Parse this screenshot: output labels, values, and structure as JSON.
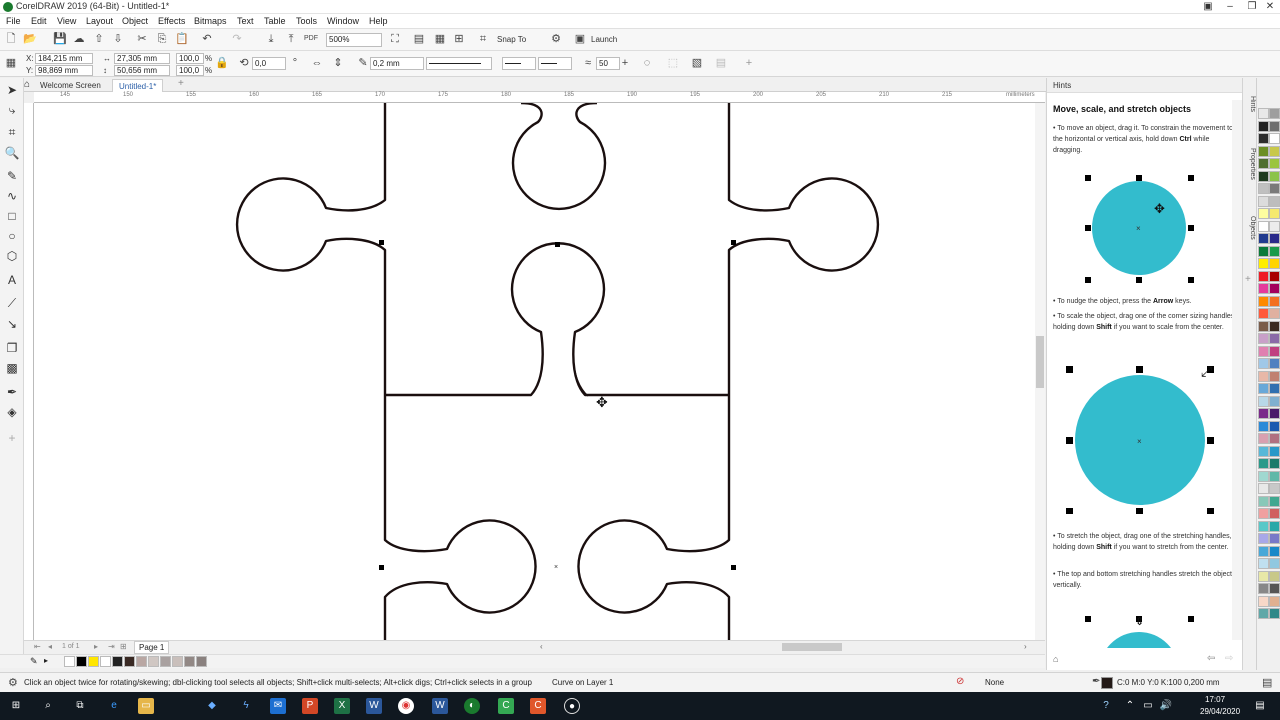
{
  "window": {
    "title": "CorelDRAW 2019 (64-Bit) - Untitled-1*"
  },
  "menu": [
    "File",
    "Edit",
    "View",
    "Layout",
    "Object",
    "Effects",
    "Bitmaps",
    "Text",
    "Table",
    "Tools",
    "Window",
    "Help"
  ],
  "toolbar": {
    "zoom": "500%",
    "snap_to": "Snap To",
    "launch": "Launch"
  },
  "propbar": {
    "x_label": "X:",
    "x": "184,215 mm",
    "y_label": "Y:",
    "y": "98,869 mm",
    "width": "27,305 mm",
    "height": "50,656 mm",
    "scale_w": "100,0",
    "scale_h": "100,0",
    "pct": "%",
    "angle": "0,0",
    "outline_width": "0,2 mm",
    "smooth": "50"
  },
  "tabs": {
    "welcome": "Welcome Screen",
    "document": "Untitled-1*"
  },
  "ruler": {
    "ticks": [
      "145",
      "150",
      "155",
      "160",
      "165",
      "170",
      "175",
      "180",
      "185",
      "190",
      "195",
      "200",
      "205",
      "210",
      "215"
    ],
    "unit": "millimeters"
  },
  "page_nav": {
    "counter": "1  of  1",
    "page": "Page 1"
  },
  "status": {
    "hint": "Click an object twice for rotating/skewing; dbl-clicking tool selects all objects; Shift+click multi-selects; Alt+click digs; Ctrl+click selects in a group",
    "object": "Curve on Layer 1",
    "fill": "None",
    "outline": "C:0 M:0 Y:0 K:100  0,200 mm"
  },
  "hints_panel": {
    "header": "Hints",
    "title": "Move, scale, and stretch objects",
    "h1a": "• To move an object, drag it. To constrain the movement to the horizontal or vertical axis, hold down ",
    "h1b": "Ctrl",
    "h1c": " while dragging.",
    "h2a": "• To nudge the object, press the ",
    "h2b": "Arrow",
    "h2c": " keys.",
    "h3a": "• To scale the object, drag one of the corner sizing handles, holding down ",
    "h3b": "Shift",
    "h3c": " if you want to scale from the center.",
    "h4a": "• To stretch the object, drag one of the stretching handles, holding down ",
    "h4b": "Shift",
    "h4c": " if you want to stretch from the center.",
    "h5": "• The top and bottom stretching handles stretch the object vertically.",
    "circle_color": "#33bccd"
  },
  "dockers": [
    "Hints",
    "Properties",
    "Objects"
  ],
  "taskbar": {
    "time": "17:07",
    "date": "29/04/2020"
  },
  "colors": {
    "outline": "#1a0f0f",
    "accent": "#2b5fa8"
  }
}
